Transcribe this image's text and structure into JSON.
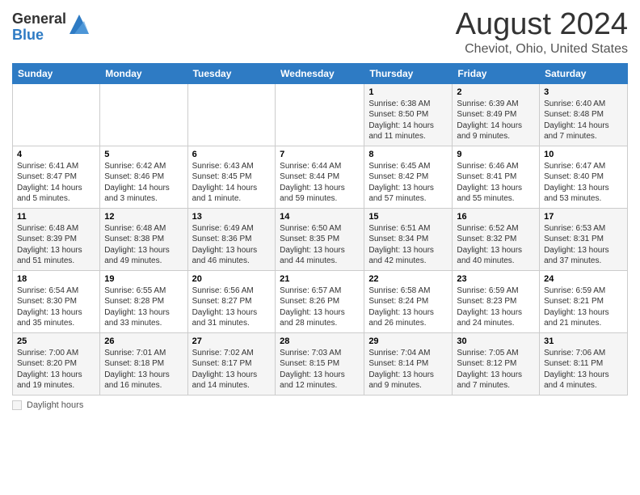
{
  "header": {
    "logo_general": "General",
    "logo_blue": "Blue",
    "title": "August 2024",
    "subtitle": "Cheviot, Ohio, United States"
  },
  "days_of_week": [
    "Sunday",
    "Monday",
    "Tuesday",
    "Wednesday",
    "Thursday",
    "Friday",
    "Saturday"
  ],
  "footer": {
    "label": "Daylight hours"
  },
  "weeks": [
    [
      {
        "day": "",
        "info": ""
      },
      {
        "day": "",
        "info": ""
      },
      {
        "day": "",
        "info": ""
      },
      {
        "day": "",
        "info": ""
      },
      {
        "day": "1",
        "info": "Sunrise: 6:38 AM\nSunset: 8:50 PM\nDaylight: 14 hours and 11 minutes."
      },
      {
        "day": "2",
        "info": "Sunrise: 6:39 AM\nSunset: 8:49 PM\nDaylight: 14 hours and 9 minutes."
      },
      {
        "day": "3",
        "info": "Sunrise: 6:40 AM\nSunset: 8:48 PM\nDaylight: 14 hours and 7 minutes."
      }
    ],
    [
      {
        "day": "4",
        "info": "Sunrise: 6:41 AM\nSunset: 8:47 PM\nDaylight: 14 hours and 5 minutes."
      },
      {
        "day": "5",
        "info": "Sunrise: 6:42 AM\nSunset: 8:46 PM\nDaylight: 14 hours and 3 minutes."
      },
      {
        "day": "6",
        "info": "Sunrise: 6:43 AM\nSunset: 8:45 PM\nDaylight: 14 hours and 1 minute."
      },
      {
        "day": "7",
        "info": "Sunrise: 6:44 AM\nSunset: 8:44 PM\nDaylight: 13 hours and 59 minutes."
      },
      {
        "day": "8",
        "info": "Sunrise: 6:45 AM\nSunset: 8:42 PM\nDaylight: 13 hours and 57 minutes."
      },
      {
        "day": "9",
        "info": "Sunrise: 6:46 AM\nSunset: 8:41 PM\nDaylight: 13 hours and 55 minutes."
      },
      {
        "day": "10",
        "info": "Sunrise: 6:47 AM\nSunset: 8:40 PM\nDaylight: 13 hours and 53 minutes."
      }
    ],
    [
      {
        "day": "11",
        "info": "Sunrise: 6:48 AM\nSunset: 8:39 PM\nDaylight: 13 hours and 51 minutes."
      },
      {
        "day": "12",
        "info": "Sunrise: 6:48 AM\nSunset: 8:38 PM\nDaylight: 13 hours and 49 minutes."
      },
      {
        "day": "13",
        "info": "Sunrise: 6:49 AM\nSunset: 8:36 PM\nDaylight: 13 hours and 46 minutes."
      },
      {
        "day": "14",
        "info": "Sunrise: 6:50 AM\nSunset: 8:35 PM\nDaylight: 13 hours and 44 minutes."
      },
      {
        "day": "15",
        "info": "Sunrise: 6:51 AM\nSunset: 8:34 PM\nDaylight: 13 hours and 42 minutes."
      },
      {
        "day": "16",
        "info": "Sunrise: 6:52 AM\nSunset: 8:32 PM\nDaylight: 13 hours and 40 minutes."
      },
      {
        "day": "17",
        "info": "Sunrise: 6:53 AM\nSunset: 8:31 PM\nDaylight: 13 hours and 37 minutes."
      }
    ],
    [
      {
        "day": "18",
        "info": "Sunrise: 6:54 AM\nSunset: 8:30 PM\nDaylight: 13 hours and 35 minutes."
      },
      {
        "day": "19",
        "info": "Sunrise: 6:55 AM\nSunset: 8:28 PM\nDaylight: 13 hours and 33 minutes."
      },
      {
        "day": "20",
        "info": "Sunrise: 6:56 AM\nSunset: 8:27 PM\nDaylight: 13 hours and 31 minutes."
      },
      {
        "day": "21",
        "info": "Sunrise: 6:57 AM\nSunset: 8:26 PM\nDaylight: 13 hours and 28 minutes."
      },
      {
        "day": "22",
        "info": "Sunrise: 6:58 AM\nSunset: 8:24 PM\nDaylight: 13 hours and 26 minutes."
      },
      {
        "day": "23",
        "info": "Sunrise: 6:59 AM\nSunset: 8:23 PM\nDaylight: 13 hours and 24 minutes."
      },
      {
        "day": "24",
        "info": "Sunrise: 6:59 AM\nSunset: 8:21 PM\nDaylight: 13 hours and 21 minutes."
      }
    ],
    [
      {
        "day": "25",
        "info": "Sunrise: 7:00 AM\nSunset: 8:20 PM\nDaylight: 13 hours and 19 minutes."
      },
      {
        "day": "26",
        "info": "Sunrise: 7:01 AM\nSunset: 8:18 PM\nDaylight: 13 hours and 16 minutes."
      },
      {
        "day": "27",
        "info": "Sunrise: 7:02 AM\nSunset: 8:17 PM\nDaylight: 13 hours and 14 minutes."
      },
      {
        "day": "28",
        "info": "Sunrise: 7:03 AM\nSunset: 8:15 PM\nDaylight: 13 hours and 12 minutes."
      },
      {
        "day": "29",
        "info": "Sunrise: 7:04 AM\nSunset: 8:14 PM\nDaylight: 13 hours and 9 minutes."
      },
      {
        "day": "30",
        "info": "Sunrise: 7:05 AM\nSunset: 8:12 PM\nDaylight: 13 hours and 7 minutes."
      },
      {
        "day": "31",
        "info": "Sunrise: 7:06 AM\nSunset: 8:11 PM\nDaylight: 13 hours and 4 minutes."
      }
    ]
  ]
}
